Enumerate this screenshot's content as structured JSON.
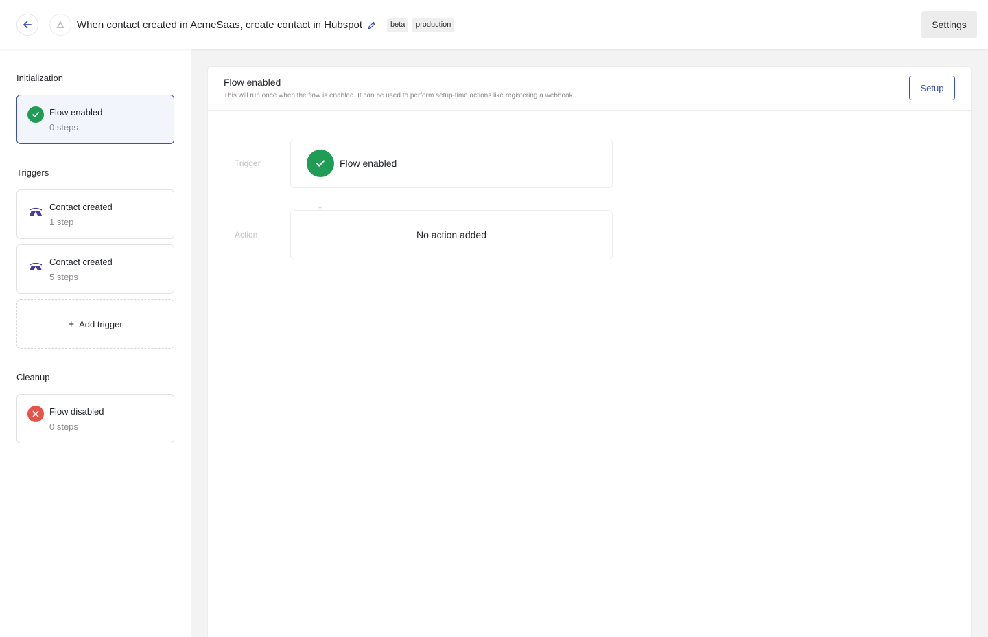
{
  "header": {
    "flow_title": "When contact created in AcmeSaas, create contact in Hubspot",
    "tags": [
      "beta",
      "production"
    ],
    "settings_label": "Settings",
    "icons": {
      "back": "arrow-left-icon",
      "app": "app-logo-icon",
      "edit": "pencil-icon"
    }
  },
  "sidebar": {
    "initialization": {
      "title": "Initialization",
      "items": [
        {
          "title": "Flow enabled",
          "subtitle": "0 steps",
          "icon": "check-circle-icon",
          "selected": true
        }
      ]
    },
    "triggers": {
      "title": "Triggers",
      "items": [
        {
          "title": "Contact created",
          "subtitle": "1 step",
          "icon": "acme-logo-icon"
        },
        {
          "title": "Contact created",
          "subtitle": "5 steps",
          "icon": "acme-logo-icon"
        }
      ],
      "add_label": "Add trigger"
    },
    "cleanup": {
      "title": "Cleanup",
      "items": [
        {
          "title": "Flow disabled",
          "subtitle": "0 steps",
          "icon": "x-circle-icon"
        }
      ]
    }
  },
  "main": {
    "title": "Flow enabled",
    "description": "This will run once when the flow is enabled. It can be used to perform setup-time actions like registering a webhook.",
    "setup_label": "Setup",
    "trigger_label": "Trigger",
    "trigger_step": "Flow enabled",
    "action_label": "Action",
    "action_empty": "No action added"
  },
  "colors": {
    "accent": "#3b4fb8",
    "success": "#1f9d55",
    "danger": "#e5534b",
    "acme_purple": "#4b3a9c"
  }
}
